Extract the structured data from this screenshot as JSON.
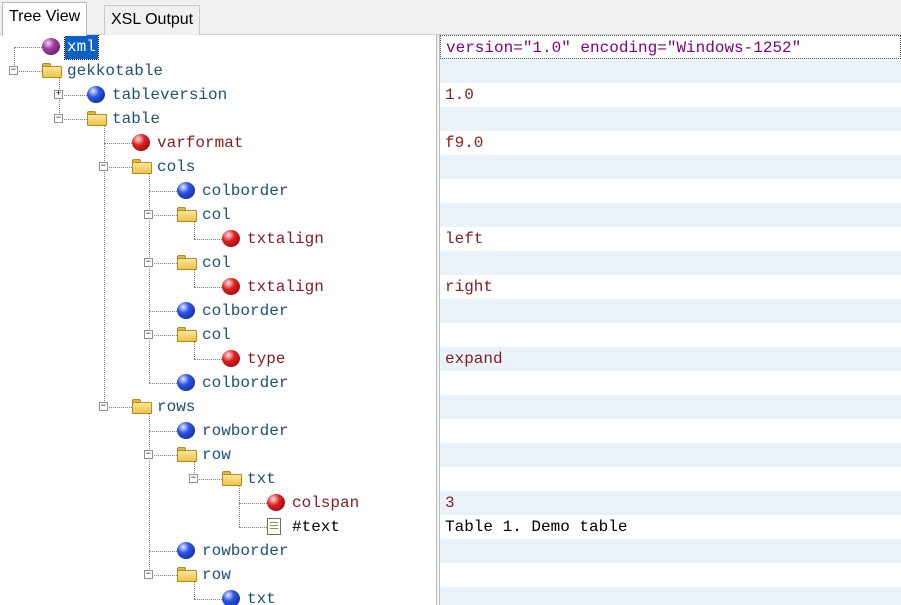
{
  "tabs": [
    {
      "label": "Tree View",
      "active": true
    },
    {
      "label": "XSL Output",
      "active": false
    }
  ],
  "tree": [
    {
      "label": "xml",
      "icon": "purple-ball-icon",
      "kind": "declaration",
      "depth": 0,
      "expander": null,
      "selected": true,
      "value": "version=\"1.0\" encoding=\"Windows-1252\""
    },
    {
      "label": "gekkotable",
      "icon": "folder-icon",
      "kind": "element",
      "depth": 0,
      "expander": "−",
      "value": ""
    },
    {
      "label": "tableversion",
      "icon": "blue-ball-icon",
      "kind": "element",
      "depth": 1,
      "expander": "+",
      "value": "1.0"
    },
    {
      "label": "table",
      "icon": "folder-icon",
      "kind": "element",
      "depth": 1,
      "expander": "−",
      "value": ""
    },
    {
      "label": "varformat",
      "icon": "red-ball-icon",
      "kind": "attribute",
      "depth": 2,
      "expander": null,
      "value": "f9.0"
    },
    {
      "label": "cols",
      "icon": "folder-icon",
      "kind": "element",
      "depth": 2,
      "expander": "−",
      "value": ""
    },
    {
      "label": "colborder",
      "icon": "blue-ball-icon",
      "kind": "element",
      "depth": 3,
      "expander": null,
      "value": ""
    },
    {
      "label": "col",
      "icon": "folder-icon",
      "kind": "element",
      "depth": 3,
      "expander": "−",
      "value": ""
    },
    {
      "label": "txtalign",
      "icon": "red-ball-icon",
      "kind": "attribute",
      "depth": 4,
      "expander": null,
      "value": "left"
    },
    {
      "label": "col",
      "icon": "folder-icon",
      "kind": "element",
      "depth": 3,
      "expander": "−",
      "value": ""
    },
    {
      "label": "txtalign",
      "icon": "red-ball-icon",
      "kind": "attribute",
      "depth": 4,
      "expander": null,
      "value": "right"
    },
    {
      "label": "colborder",
      "icon": "blue-ball-icon",
      "kind": "element",
      "depth": 3,
      "expander": null,
      "value": ""
    },
    {
      "label": "col",
      "icon": "folder-icon",
      "kind": "element",
      "depth": 3,
      "expander": "−",
      "value": ""
    },
    {
      "label": "type",
      "icon": "red-ball-icon",
      "kind": "attribute",
      "depth": 4,
      "expander": null,
      "value": "expand"
    },
    {
      "label": "colborder",
      "icon": "blue-ball-icon",
      "kind": "element",
      "depth": 3,
      "expander": null,
      "value": ""
    },
    {
      "label": "rows",
      "icon": "folder-icon",
      "kind": "element",
      "depth": 2,
      "expander": "−",
      "value": ""
    },
    {
      "label": "rowborder",
      "icon": "blue-ball-icon",
      "kind": "element",
      "depth": 3,
      "expander": null,
      "value": ""
    },
    {
      "label": "row",
      "icon": "folder-icon",
      "kind": "element",
      "depth": 3,
      "expander": "−",
      "value": ""
    },
    {
      "label": "txt",
      "icon": "folder-icon",
      "kind": "element",
      "depth": 4,
      "expander": "−",
      "value": ""
    },
    {
      "label": "colspan",
      "icon": "red-ball-icon",
      "kind": "attribute",
      "depth": 5,
      "expander": null,
      "value": "3"
    },
    {
      "label": "#text",
      "icon": "text-node-icon",
      "kind": "text",
      "depth": 5,
      "expander": null,
      "value": "Table 1. Demo table"
    },
    {
      "label": "rowborder",
      "icon": "blue-ball-icon",
      "kind": "element",
      "depth": 3,
      "expander": null,
      "value": ""
    },
    {
      "label": "row",
      "icon": "folder-icon",
      "kind": "element",
      "depth": 3,
      "expander": "−",
      "value": ""
    },
    {
      "label": "txt",
      "icon": "blue-ball-icon",
      "kind": "element",
      "depth": 4,
      "expander": null,
      "value": ""
    }
  ]
}
